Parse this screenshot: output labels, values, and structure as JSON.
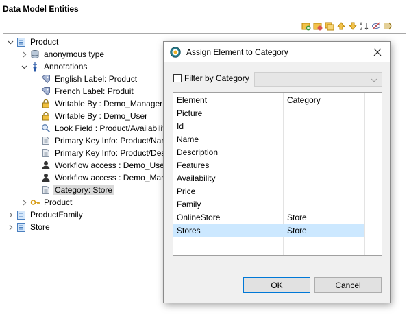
{
  "panel": {
    "title": "Data Model Entities"
  },
  "toolbar": {
    "icons": [
      "add-element-icon",
      "add-copy-icon",
      "duplicate-icon",
      "move-up-icon",
      "move-down-icon",
      "sort-az-icon",
      "hide-icon",
      "expand-icon"
    ]
  },
  "tree": {
    "items": [
      {
        "label": "Product"
      },
      {
        "label": "anonymous type"
      },
      {
        "label": "Annotations"
      },
      {
        "label": "English Label: Product"
      },
      {
        "label": "French Label: Produit"
      },
      {
        "label": "Writable By : Demo_Manager"
      },
      {
        "label": "Writable By : Demo_User"
      },
      {
        "label": "Look Field : Product/Availability"
      },
      {
        "label": "Primary Key Info:  Product/Name"
      },
      {
        "label": "Primary Key Info:  Product/Description"
      },
      {
        "label": "Workflow access : Demo_User#"
      },
      {
        "label": "Workflow access : Demo_Manager"
      },
      {
        "label": "Category: Store"
      },
      {
        "label": "Product"
      },
      {
        "label": "ProductFamily"
      },
      {
        "label": "Store"
      }
    ]
  },
  "dialog": {
    "title": "Assign Element to Category",
    "filter_label": "Filter by Category",
    "filter_value": "",
    "columns": [
      "Element",
      "Category"
    ],
    "rows": [
      {
        "element": "Picture",
        "category": ""
      },
      {
        "element": "Id",
        "category": ""
      },
      {
        "element": "Name",
        "category": ""
      },
      {
        "element": "Description",
        "category": ""
      },
      {
        "element": "Features",
        "category": ""
      },
      {
        "element": "Availability",
        "category": ""
      },
      {
        "element": "Price",
        "category": ""
      },
      {
        "element": "Family",
        "category": ""
      },
      {
        "element": "OnlineStore",
        "category": "Store"
      },
      {
        "element": "Stores",
        "category": "Store"
      }
    ],
    "ok_label": "OK",
    "cancel_label": "Cancel"
  },
  "colors": {
    "selection": "#cce8ff",
    "accent": "#0078d7",
    "tree_selection": "#d9d9d9"
  }
}
